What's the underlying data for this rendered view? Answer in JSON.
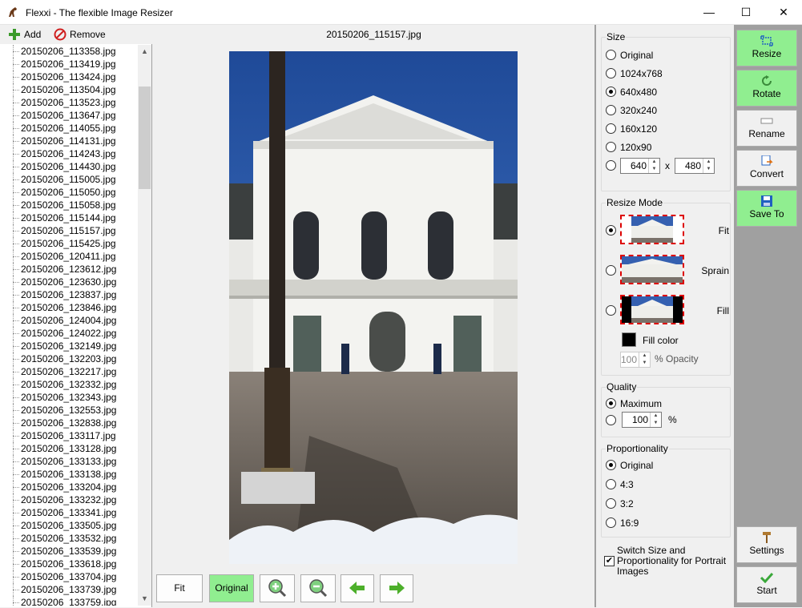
{
  "window": {
    "title": "Flexxi - The flexible Image Resizer",
    "minimize": "—",
    "maximize": "☐",
    "close": "✕"
  },
  "toolbar": {
    "add_label": "Add",
    "remove_label": "Remove"
  },
  "files": [
    "20150206_113358.jpg",
    "20150206_113419.jpg",
    "20150206_113424.jpg",
    "20150206_113504.jpg",
    "20150206_113523.jpg",
    "20150206_113647.jpg",
    "20150206_114055.jpg",
    "20150206_114131.jpg",
    "20150206_114243.jpg",
    "20150206_114430.jpg",
    "20150206_115005.jpg",
    "20150206_115050.jpg",
    "20150206_115058.jpg",
    "20150206_115144.jpg",
    "20150206_115157.jpg",
    "20150206_115425.jpg",
    "20150206_120411.jpg",
    "20150206_123612.jpg",
    "20150206_123630.jpg",
    "20150206_123837.jpg",
    "20150206_123846.jpg",
    "20150206_124004.jpg",
    "20150206_124022.jpg",
    "20150206_132149.jpg",
    "20150206_132203.jpg",
    "20150206_132217.jpg",
    "20150206_132332.jpg",
    "20150206_132343.jpg",
    "20150206_132553.jpg",
    "20150206_132838.jpg",
    "20150206_133117.jpg",
    "20150206_133128.jpg",
    "20150206_133133.jpg",
    "20150206_133138.jpg",
    "20150206_133204.jpg",
    "20150206_133232.jpg",
    "20150206_133341.jpg",
    "20150206_133505.jpg",
    "20150206_133532.jpg",
    "20150206_133539.jpg",
    "20150206_133618.jpg",
    "20150206_133704.jpg",
    "20150206_133739.jpg",
    "20150206_133759.jpg"
  ],
  "preview": {
    "filename": "20150206_115157.jpg",
    "fit_label": "Fit",
    "original_label": "Original"
  },
  "size": {
    "legend": "Size",
    "options": [
      "Original",
      "1024x768",
      "640x480",
      "320x240",
      "160x120",
      "120x90"
    ],
    "selected": "640x480",
    "custom_width": "640",
    "custom_x": "x",
    "custom_height": "480"
  },
  "resize_mode": {
    "legend": "Resize Mode",
    "fit_label": "Fit",
    "sprain_label": "Sprain",
    "fill_label": "Fill",
    "fill_color_label": "Fill color",
    "opacity_value": "100",
    "opacity_label": "% Opacity"
  },
  "quality": {
    "legend": "Quality",
    "maximum_label": "Maximum",
    "custom_value": "100",
    "percent": "%"
  },
  "proportionality": {
    "legend": "Proportionality",
    "options": [
      "Original",
      "4:3",
      "3:2",
      "16:9"
    ],
    "selected": "Original",
    "switch_label": "Switch Size and Proportionality for Portrait Images"
  },
  "actions": {
    "resize": "Resize",
    "rotate": "Rotate",
    "rename": "Rename",
    "convert": "Convert",
    "save_to": "Save To",
    "settings": "Settings",
    "start": "Start"
  },
  "colors": {
    "active_green": "#90ee90",
    "dash_red": "#dd0000"
  }
}
